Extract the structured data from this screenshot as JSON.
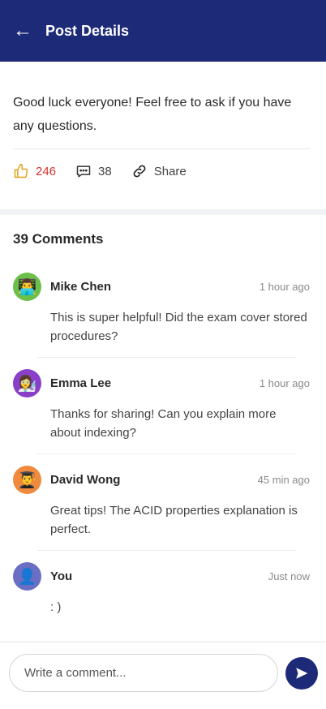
{
  "header": {
    "back_icon": "arrow-left-icon",
    "title": "Post Details"
  },
  "post": {
    "text": "Good luck everyone! Feel free to ask if you have any questions.",
    "likes": "246",
    "comments_count": "38",
    "share_label": "Share",
    "like_color": "#d0342c"
  },
  "comments_section": {
    "title": "39 Comments",
    "items": [
      {
        "name": "Mike Chen",
        "time": "1 hour ago",
        "text": "This is super helpful! Did the exam cover stored procedures?",
        "avatar_icon": "👨‍💻",
        "avatar_color": "#6cc04a"
      },
      {
        "name": "Emma Lee",
        "time": "1 hour ago",
        "text": "Thanks for sharing! Can you explain more about indexing?",
        "avatar_icon": "👩‍🔬",
        "avatar_color": "#8a3fc9"
      },
      {
        "name": "David Wong",
        "time": "45 min ago",
        "text": "Great tips! The ACID properties explanation is perfect.",
        "avatar_icon": "👨‍🎓",
        "avatar_color": "#f08a3c"
      },
      {
        "name": "You",
        "time": "Just now",
        "text": ": )",
        "avatar_icon": "👤",
        "avatar_color": "#6a6fc4"
      }
    ]
  },
  "composer": {
    "placeholder": "Write a comment...",
    "send_icon": "send-icon"
  },
  "theme": {
    "primary": "#1d2a78"
  }
}
